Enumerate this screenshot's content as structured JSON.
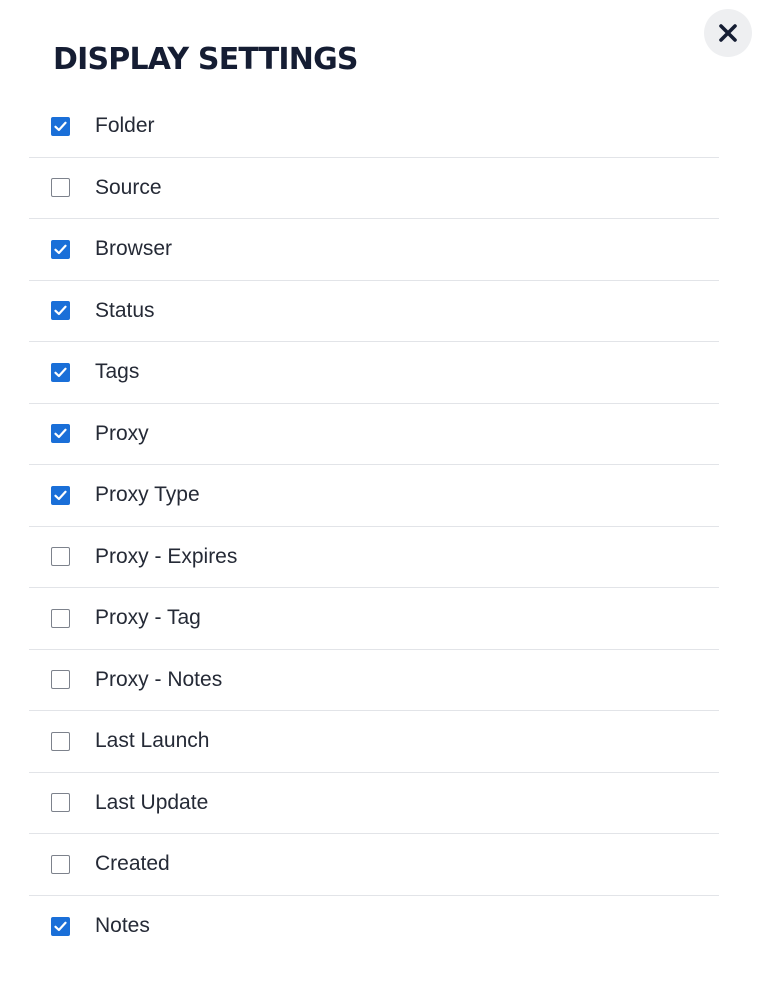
{
  "dialog": {
    "title": "DISPLAY SETTINGS",
    "close_icon": "close-icon"
  },
  "colors": {
    "accent": "#1a6fd8",
    "title": "#151d33",
    "divider": "#e2e4e8",
    "close_bg": "#eeeff1"
  },
  "settings": [
    {
      "label": "Folder",
      "checked": true
    },
    {
      "label": "Source",
      "checked": false
    },
    {
      "label": "Browser",
      "checked": true
    },
    {
      "label": "Status",
      "checked": true
    },
    {
      "label": "Tags",
      "checked": true
    },
    {
      "label": "Proxy",
      "checked": true
    },
    {
      "label": "Proxy Type",
      "checked": true
    },
    {
      "label": "Proxy - Expires",
      "checked": false
    },
    {
      "label": "Proxy - Tag",
      "checked": false
    },
    {
      "label": "Proxy - Notes",
      "checked": false
    },
    {
      "label": "Last Launch",
      "checked": false
    },
    {
      "label": "Last Update",
      "checked": false
    },
    {
      "label": "Created",
      "checked": false
    },
    {
      "label": "Notes",
      "checked": true
    }
  ]
}
